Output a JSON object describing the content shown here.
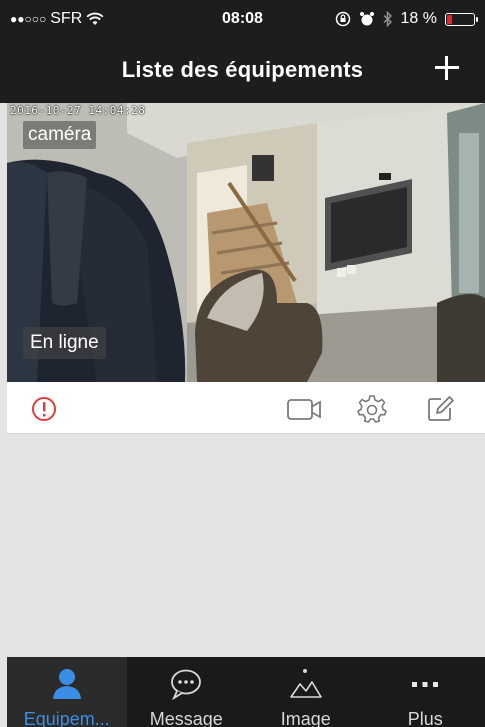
{
  "status_bar": {
    "carrier": "SFR",
    "time": "08:08",
    "battery": "18 %",
    "battery_color": "#e8262a"
  },
  "nav": {
    "title": "Liste des équipements"
  },
  "camera": {
    "timestamp": "2016-10-27 14:04:28",
    "name": "caméra",
    "status": "En ligne"
  },
  "actions": {
    "alert_color": "#e33b3b",
    "icon_color": "#7a7a7a",
    "icons": [
      "alert-icon",
      "video-camera-icon",
      "settings-gear-icon",
      "edit-icon"
    ]
  },
  "tabs": [
    {
      "label": "Equipem...",
      "icon": "user-icon",
      "active": true
    },
    {
      "label": "Message",
      "icon": "chat-bubble-icon",
      "active": false
    },
    {
      "label": "Image",
      "icon": "image-icon",
      "active": false
    },
    {
      "label": "Plus",
      "icon": "more-icon",
      "active": false
    }
  ],
  "colors": {
    "accent": "#3a8ee6",
    "nav_bg": "#1d1d1d",
    "tabbar_bg": "#1a1a1a"
  }
}
